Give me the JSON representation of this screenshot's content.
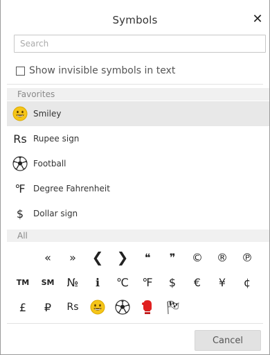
{
  "dialog": {
    "title": "Symbols",
    "close_glyph": "✕",
    "search_placeholder": "Search",
    "show_invisible_label": "Show invisible symbols in text",
    "show_invisible_checked": false
  },
  "favorites": {
    "header": "Favorites",
    "items": [
      {
        "symbol": "smiley-icon",
        "label": "Smiley",
        "selected": true
      },
      {
        "symbol": "Rs",
        "label": "Rupee sign",
        "selected": false
      },
      {
        "symbol": "football-icon",
        "label": "Football",
        "selected": false
      },
      {
        "symbol": "℉",
        "label": "Degree Fahrenheit",
        "selected": false
      },
      {
        "symbol": "$",
        "label": "Dollar sign",
        "selected": false
      }
    ]
  },
  "all": {
    "header": "All",
    "rows": [
      [
        "",
        "«",
        "»",
        "❮",
        "❯",
        "❝",
        "❞",
        "©",
        "®",
        "℗"
      ],
      [
        "TM",
        "SM",
        "№",
        "ℹ",
        "℃",
        "℉",
        "$",
        "€",
        "¥",
        "¢"
      ],
      [
        "£",
        "₽",
        "Rs",
        "smiley-icon",
        "football-icon",
        "boxing-glove-icon",
        "checkered-flag-icon",
        "",
        "",
        ""
      ]
    ]
  },
  "footer": {
    "cancel_label": "Cancel"
  },
  "colors": {
    "smiley_face": "#f5c518",
    "glove": "#e02020",
    "selected_row": "#e8e8e8",
    "section_header_bg": "#f0f0f0"
  }
}
